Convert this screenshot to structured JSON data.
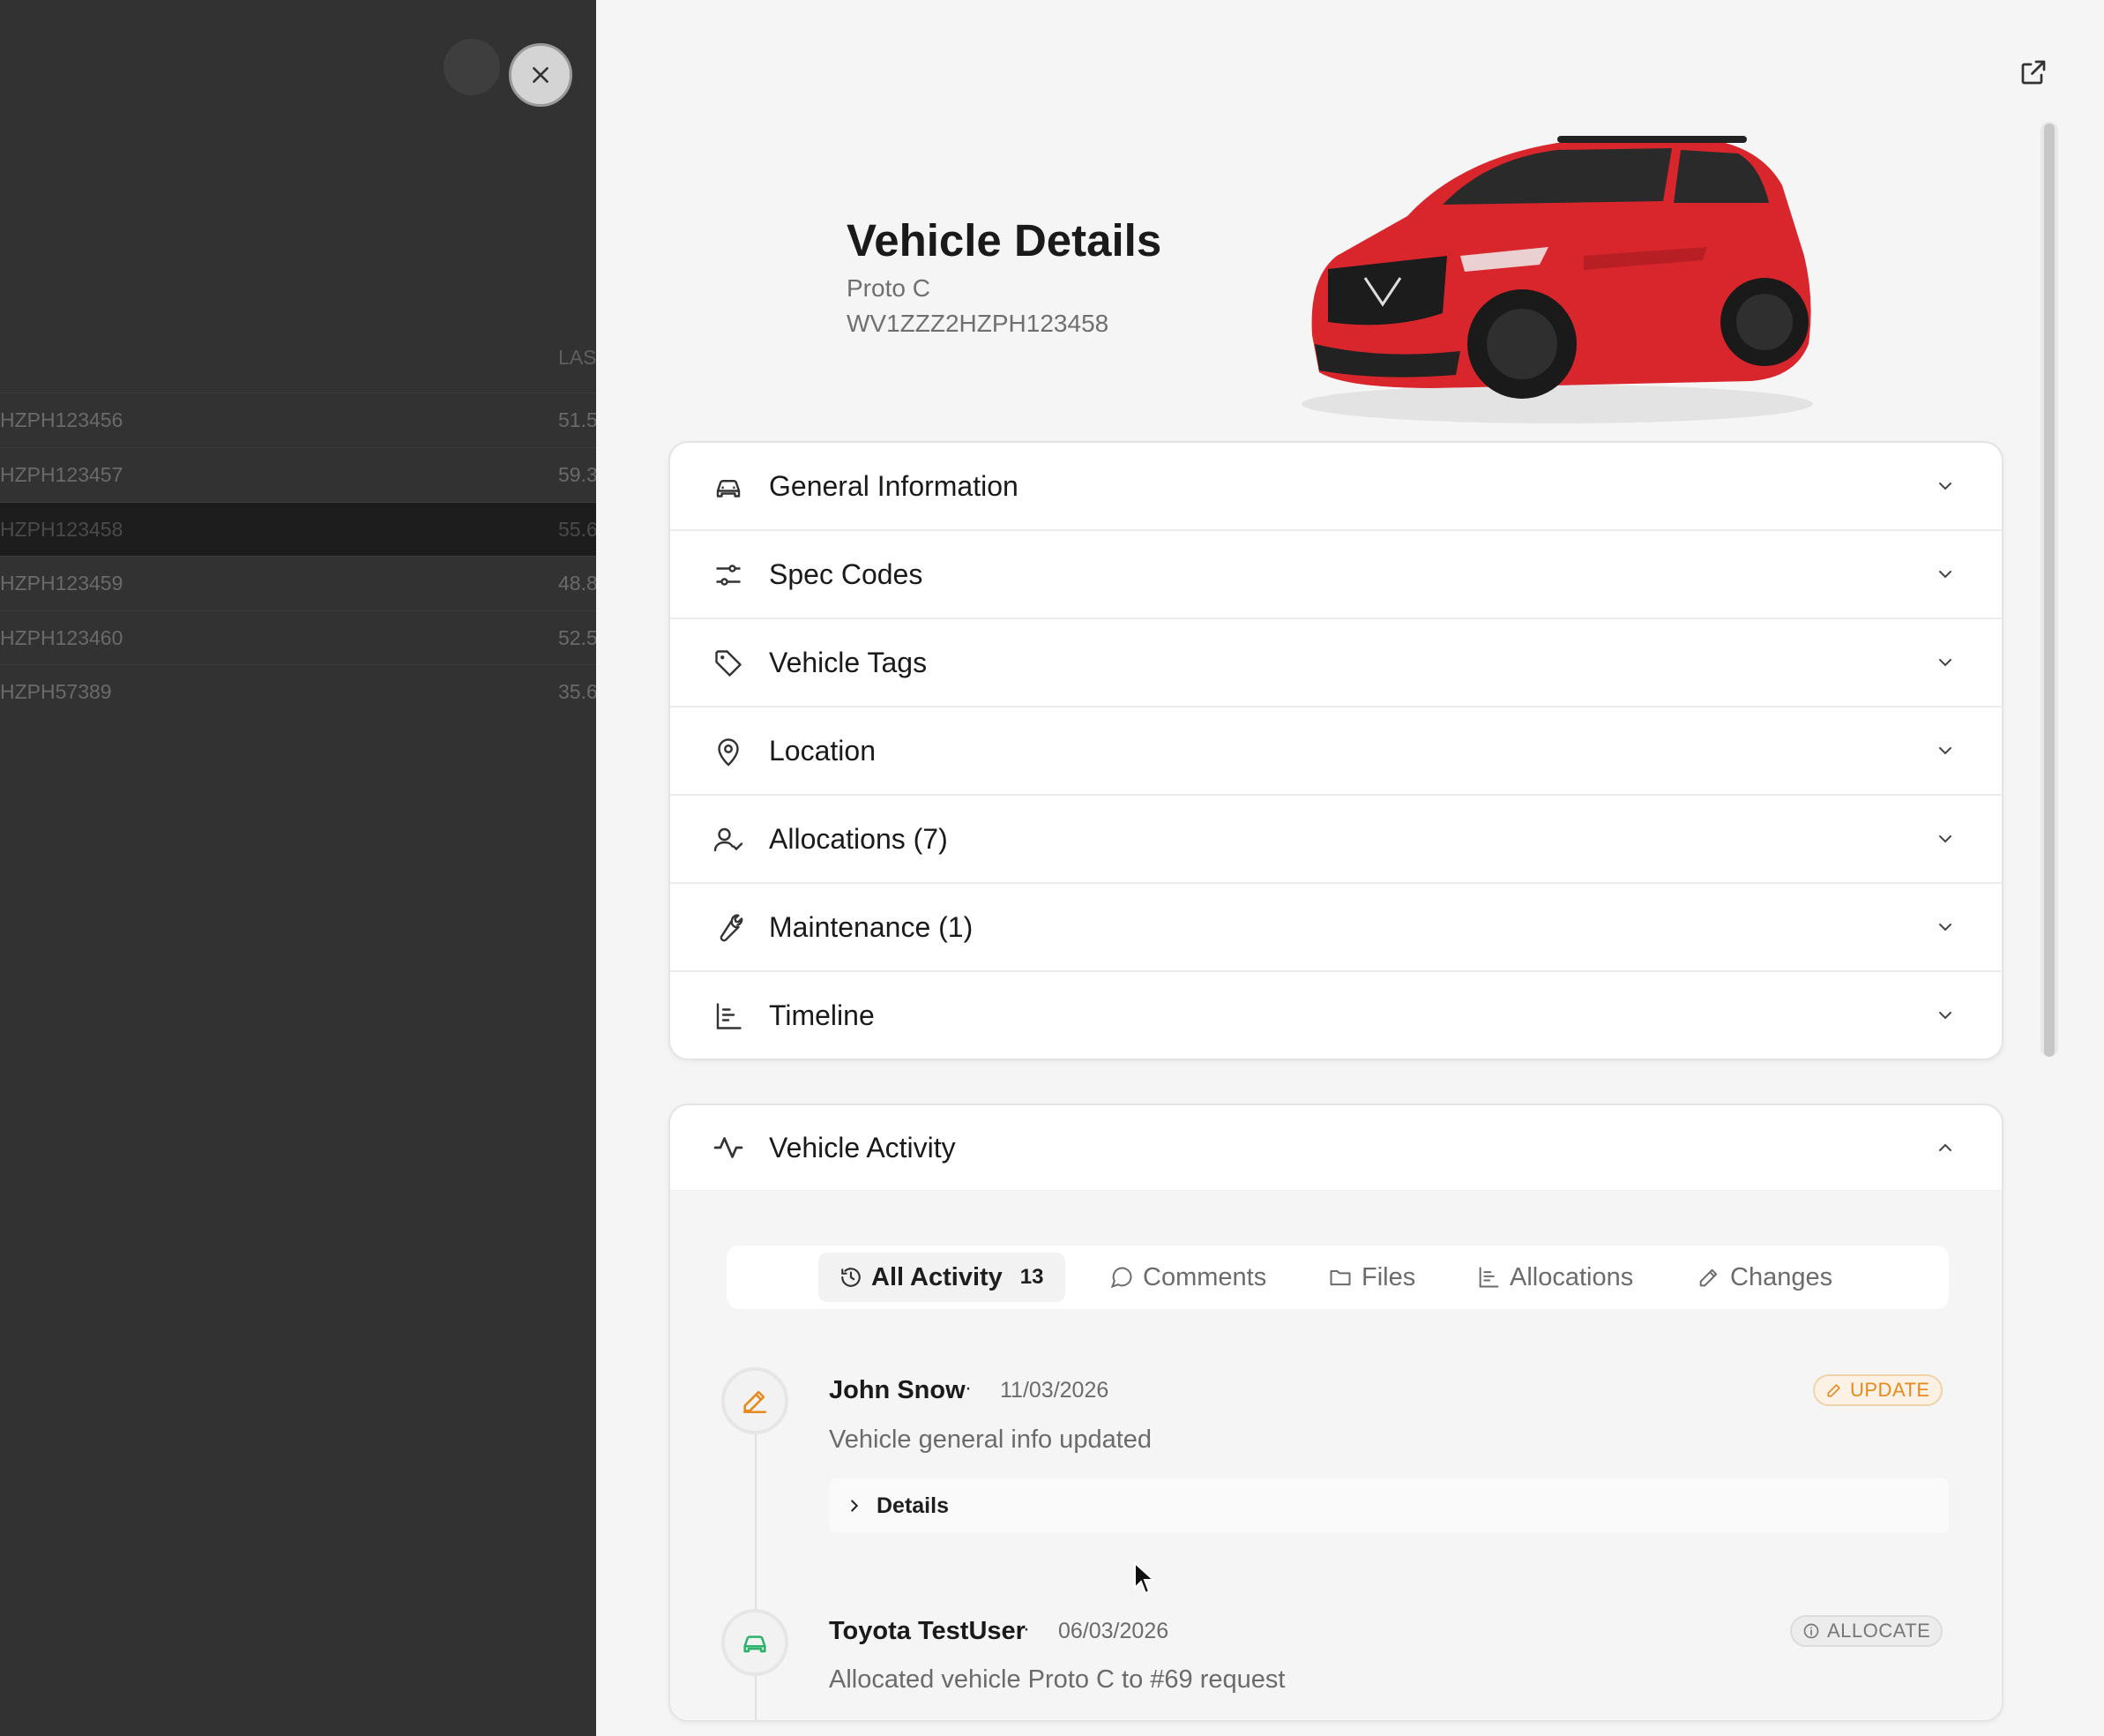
{
  "background_table": {
    "header": "LAS",
    "rows": [
      {
        "vin": "HZPH123456",
        "value": "51.5",
        "selected": false
      },
      {
        "vin": "HZPH123457",
        "value": "59.3",
        "selected": false
      },
      {
        "vin": "HZPH123458",
        "value": "55.6",
        "selected": true
      },
      {
        "vin": "HZPH123459",
        "value": "48.8",
        "selected": false
      },
      {
        "vin": "HZPH123460",
        "value": "52.5",
        "selected": false
      },
      {
        "vin": "HZPH57389",
        "value": "35.6",
        "selected": false
      }
    ]
  },
  "header": {
    "title": "Vehicle Details",
    "model": "Proto C",
    "vin": "WV1ZZZ2HZPH123458"
  },
  "sections": [
    {
      "label": "General Information",
      "icon": "car-icon"
    },
    {
      "label": "Spec Codes",
      "icon": "sliders-icon"
    },
    {
      "label": "Vehicle Tags",
      "icon": "tag-icon"
    },
    {
      "label": "Location",
      "icon": "map-pin-icon"
    },
    {
      "label": "Allocations (7)",
      "icon": "user-check-icon"
    },
    {
      "label": "Maintenance (1)",
      "icon": "wrench-icon"
    },
    {
      "label": "Timeline",
      "icon": "timeline-icon"
    }
  ],
  "activity": {
    "title": "Vehicle Activity",
    "tabs": [
      {
        "label": "All Activity",
        "count": "13",
        "icon": "history-icon"
      },
      {
        "label": "Comments",
        "icon": "comment-icon"
      },
      {
        "label": "Files",
        "icon": "folder-icon"
      },
      {
        "label": "Allocations",
        "icon": "list-icon"
      },
      {
        "label": "Changes",
        "icon": "pencil-icon"
      }
    ],
    "entries": [
      {
        "user": "John Snow",
        "date": "11/03/2026",
        "text": "Vehicle general info updated",
        "badge": "UPDATE",
        "details_label": "Details"
      },
      {
        "user": "Toyota TestUser",
        "date": "06/03/2026",
        "text": "Allocated vehicle Proto C to #69 request",
        "badge": "ALLOCATE"
      }
    ],
    "separator": "·"
  },
  "colors": {
    "accent_update": "#e68a1e",
    "accent_allocate_icon": "#2db36a",
    "car_body": "#d8262c"
  }
}
